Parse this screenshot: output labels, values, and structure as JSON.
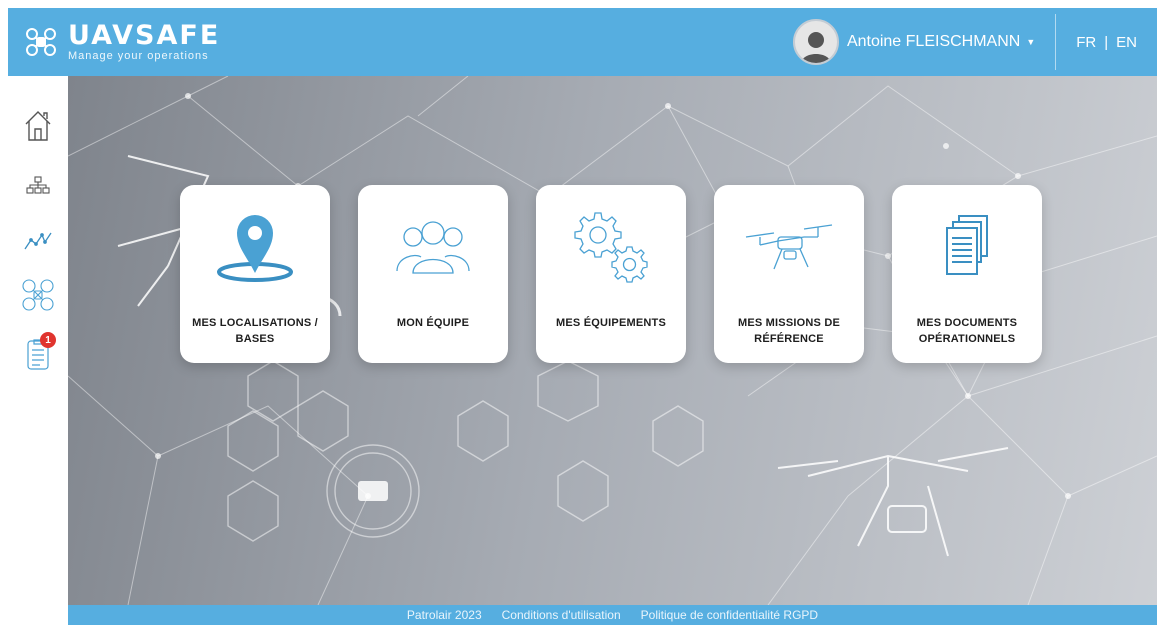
{
  "theme": {
    "accent": "#56aee0",
    "badge_color": "#e0342e"
  },
  "header": {
    "brand_name": "UAVSAFE",
    "tagline": "Manage your operations",
    "user_name": "Antoine FLEISCHMANN",
    "languages": [
      "FR",
      "EN"
    ],
    "language_separator": "|"
  },
  "sidebar": {
    "items": [
      {
        "icon": "home-icon"
      },
      {
        "icon": "org-chart-icon"
      },
      {
        "icon": "activity-chart-icon"
      },
      {
        "icon": "drone-icon"
      },
      {
        "icon": "checklist-icon",
        "badge": "1"
      }
    ]
  },
  "cards": [
    {
      "label": "MES LOCALISATIONS / BASES",
      "icon": "location-pin-icon"
    },
    {
      "label": "MON ÉQUIPE",
      "icon": "team-icon"
    },
    {
      "label": "MES ÉQUIPEMENTS",
      "icon": "gears-icon"
    },
    {
      "label": "MES MISSIONS DE RÉFÉRENCE",
      "icon": "drone-icon"
    },
    {
      "label": "MES DOCUMENTS OPÉRATIONNELS",
      "icon": "documents-icon"
    }
  ],
  "footer": {
    "copyright": "Patrolair 2023",
    "terms": "Conditions d'utilisation",
    "privacy": "Politique de confidentialité RGPD"
  }
}
